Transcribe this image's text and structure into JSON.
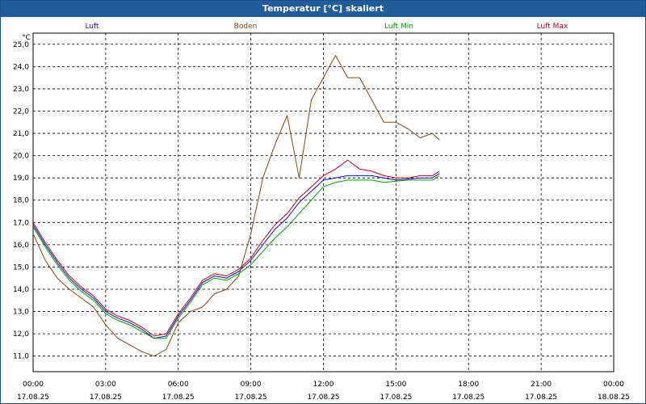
{
  "window": {
    "title": "Temperatur [°C] skaliert"
  },
  "chart_data": {
    "type": "line",
    "title": "Temperatur [°C] skaliert",
    "ylabel": "°C",
    "xlabel": "",
    "ylim": [
      10.3,
      25.5
    ],
    "xlim": [
      "17.08.25 00:00",
      "18.08.25 00:00"
    ],
    "grid": true,
    "legend_position": "top",
    "y_ticks": [
      "11,0",
      "12,0",
      "13,0",
      "14,0",
      "15,0",
      "16,0",
      "17,0",
      "18,0",
      "19,0",
      "20,0",
      "21,0",
      "22,0",
      "23,0",
      "24,0",
      "25,0"
    ],
    "x_ticks": [
      {
        "time": "00:00",
        "date": "17.08.25"
      },
      {
        "time": "03:00",
        "date": "17.08.25"
      },
      {
        "time": "06:00",
        "date": "17.08.25"
      },
      {
        "time": "09:00",
        "date": "17.08.25"
      },
      {
        "time": "12:00",
        "date": "17.08.25"
      },
      {
        "time": "15:00",
        "date": "17.08.25"
      },
      {
        "time": "18:00",
        "date": "17.08.25"
      },
      {
        "time": "21:00",
        "date": "17.08.25"
      },
      {
        "time": "00:00",
        "date": "18.08.25"
      }
    ],
    "series": [
      {
        "name": "Luft",
        "color": "#1010c0",
        "x": [
          0,
          0.5,
          1,
          1.5,
          2,
          2.5,
          3,
          3.5,
          4,
          4.5,
          5,
          5.5,
          6,
          6.5,
          7,
          7.5,
          8,
          8.5,
          9,
          9.5,
          10,
          10.5,
          11,
          11.5,
          12,
          12.5,
          13,
          13.5,
          14,
          14.5,
          15,
          15.5,
          16,
          16.5,
          16.8
        ],
        "y": [
          16.9,
          16.0,
          15.2,
          14.5,
          14.0,
          13.6,
          13.0,
          12.7,
          12.5,
          12.2,
          11.8,
          11.9,
          12.8,
          13.5,
          14.3,
          14.6,
          14.5,
          14.8,
          15.3,
          16.0,
          16.7,
          17.2,
          17.9,
          18.4,
          18.9,
          19.0,
          19.1,
          19.1,
          19.1,
          19.0,
          18.9,
          18.95,
          19.0,
          19.0,
          19.2
        ]
      },
      {
        "name": "Boden",
        "color": "#8b4513",
        "x": [
          0,
          0.5,
          1,
          1.5,
          2,
          2.5,
          3,
          3.5,
          4,
          4.5,
          5,
          5.5,
          6,
          6.5,
          7,
          7.5,
          8,
          8.5,
          9,
          9.5,
          10,
          10.5,
          11,
          11.5,
          12,
          12.5,
          13,
          13.5,
          14,
          14.5,
          15,
          15.5,
          16,
          16.5,
          16.8
        ],
        "y": [
          16.5,
          15.3,
          14.5,
          14.0,
          13.6,
          13.2,
          12.4,
          11.8,
          11.5,
          11.2,
          11.0,
          11.3,
          12.5,
          13.0,
          13.2,
          13.8,
          14.0,
          14.6,
          16.5,
          19.0,
          20.5,
          21.8,
          19.0,
          22.5,
          23.5,
          24.5,
          23.5,
          23.5,
          22.5,
          21.5,
          21.5,
          21.2,
          20.8,
          21.0,
          20.7
        ]
      },
      {
        "name": "Luft Min",
        "color": "#00a000",
        "x": [
          0,
          0.5,
          1,
          1.5,
          2,
          2.5,
          3,
          3.5,
          4,
          4.5,
          5,
          5.5,
          6,
          6.5,
          7,
          7.5,
          8,
          8.5,
          9,
          9.5,
          10,
          10.5,
          11,
          11.5,
          12,
          12.5,
          13,
          13.5,
          14,
          14.5,
          15,
          15.5,
          16,
          16.5,
          16.8
        ],
        "y": [
          16.8,
          15.9,
          15.1,
          14.4,
          13.9,
          13.5,
          12.9,
          12.6,
          12.4,
          12.1,
          11.8,
          11.8,
          12.7,
          13.4,
          14.2,
          14.5,
          14.4,
          14.7,
          15.1,
          15.7,
          16.3,
          16.8,
          17.4,
          18.0,
          18.6,
          18.8,
          18.9,
          18.9,
          18.9,
          18.8,
          18.85,
          18.9,
          18.9,
          18.9,
          19.1
        ]
      },
      {
        "name": "Luft Max",
        "color": "#c00020",
        "x": [
          0,
          0.5,
          1,
          1.5,
          2,
          2.5,
          3,
          3.5,
          4,
          4.5,
          5,
          5.5,
          6,
          6.5,
          7,
          7.5,
          8,
          8.5,
          9,
          9.5,
          10,
          10.5,
          11,
          11.5,
          12,
          12.5,
          13,
          13.5,
          14,
          14.5,
          15,
          15.5,
          16,
          16.5,
          16.8
        ],
        "y": [
          17.0,
          16.1,
          15.3,
          14.6,
          14.1,
          13.7,
          13.1,
          12.8,
          12.6,
          12.3,
          11.9,
          12.0,
          12.9,
          13.6,
          14.4,
          14.7,
          14.6,
          14.9,
          15.4,
          16.2,
          16.9,
          17.4,
          18.1,
          18.6,
          19.1,
          19.4,
          19.8,
          19.4,
          19.3,
          19.1,
          19.0,
          19.0,
          19.1,
          19.1,
          19.3
        ]
      }
    ]
  }
}
